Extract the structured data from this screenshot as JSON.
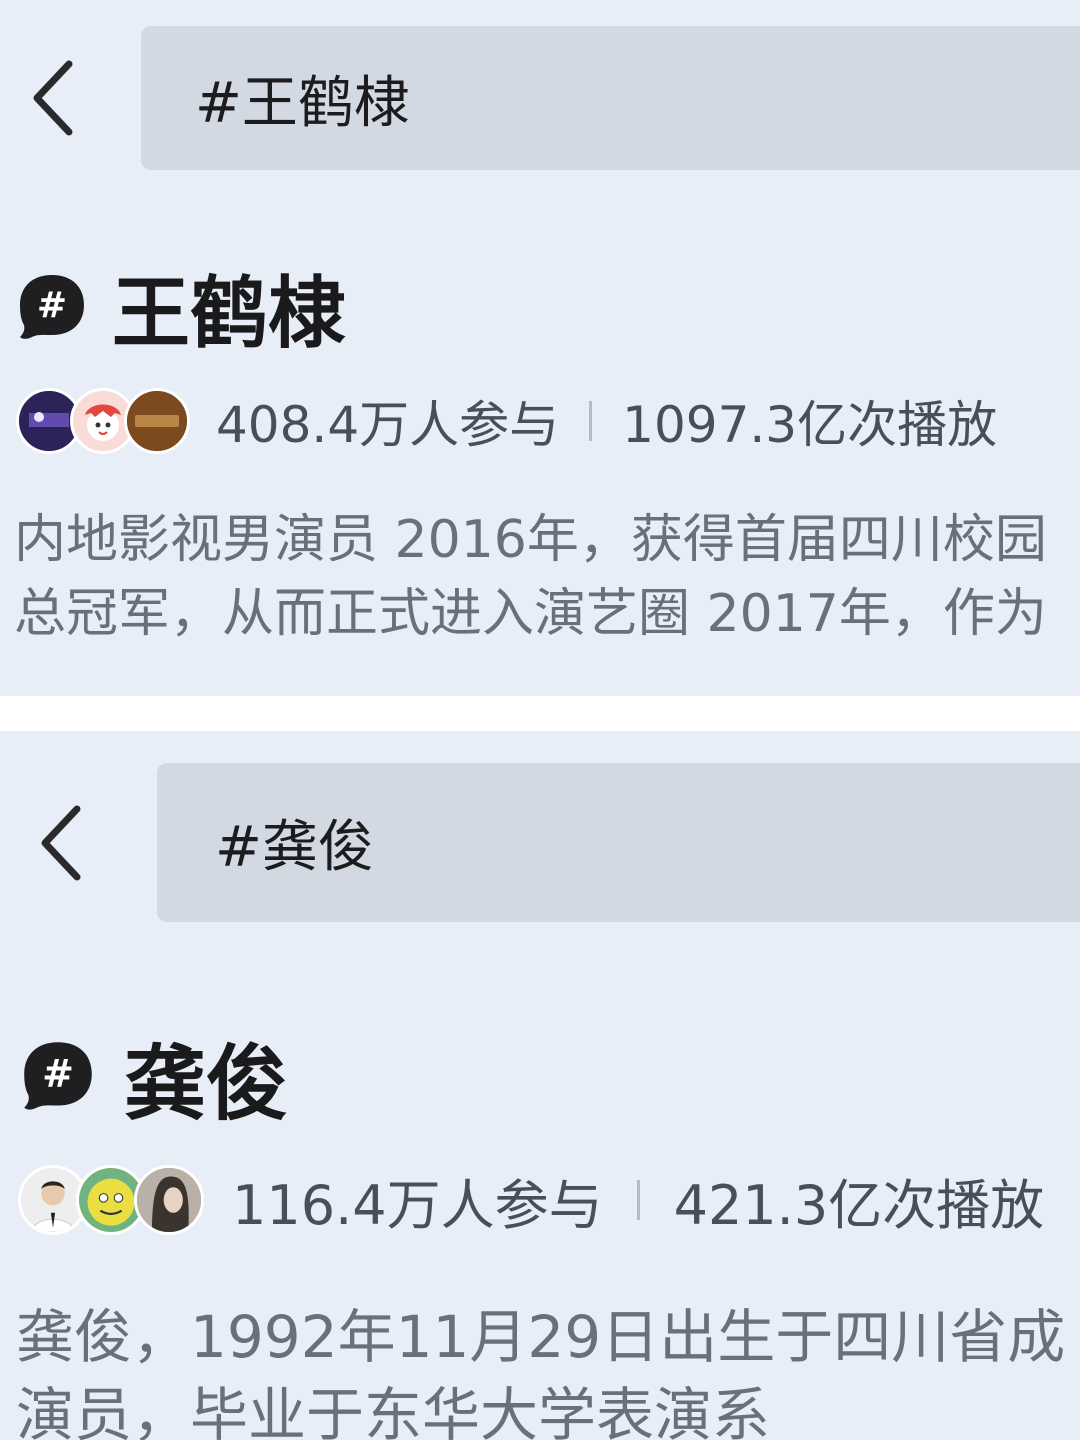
{
  "top": {
    "search_text": "#王鹤棣",
    "title": "王鹤棣",
    "participants": "408.4万人参与",
    "plays": "1097.3亿次播放",
    "desc_line1": "内地影视男演员 2016年，获得首届四川校园",
    "desc_line2": "总冠军，从而正式进入演艺圈 2017年，作为",
    "avatars": [
      {
        "name": "avatar-purple",
        "color": "#3b2b6e"
      },
      {
        "name": "avatar-cartoon",
        "color": "#f7d7d4"
      },
      {
        "name": "avatar-brown",
        "color": "#7a4c22"
      }
    ]
  },
  "bottom": {
    "search_text": "#龚俊",
    "title": "龚俊",
    "participants": "116.4万人参与",
    "plays": "421.3亿次播放",
    "desc_line1": "龚俊，1992年11月29日出生于四川省成",
    "desc_line2": "演员，毕业于东华大学表演系",
    "avatars": [
      {
        "name": "avatar-person",
        "color": "#f2f2f2"
      },
      {
        "name": "avatar-yellow-cartoon",
        "color": "#e8e04a"
      },
      {
        "name": "avatar-girl",
        "color": "#8a7f78"
      }
    ]
  },
  "colors": {
    "background": "#e8eef8",
    "search_box": "#d3d9e2",
    "divider_band": "#ffffff"
  }
}
